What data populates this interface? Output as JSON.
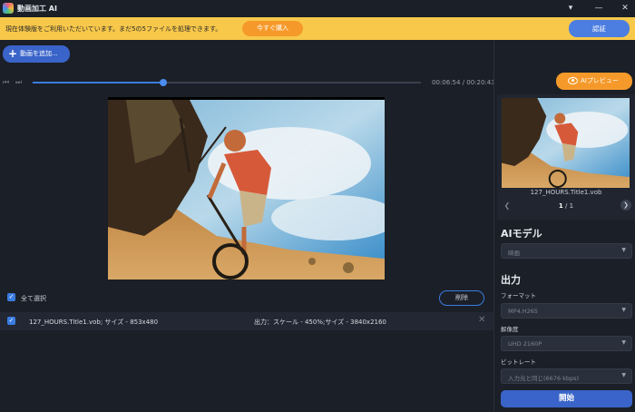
{
  "app": {
    "title": "動画加工 AI"
  },
  "window_controls": {
    "menu": "▾",
    "minimize": "—",
    "close": "✕"
  },
  "banner": {
    "text": "現在体験版をご利用いただいています。まだ5の5ファイルを処理できます。",
    "buy_label": "今すぐ購入",
    "auth_label": "認証",
    "bg_color": "#f8c84a",
    "buy_color": "#f59a2a"
  },
  "toolbar": {
    "add_video_label": "動画を追加..."
  },
  "player": {
    "time": "00:06:54 / 00:20:43",
    "progress": 0.333,
    "prev_icon": "skip-back-icon",
    "next_icon": "skip-forward-icon"
  },
  "list": {
    "select_all_label": "全て選択",
    "delete_label": "削除",
    "files": [
      {
        "name": "127_HOURS.Title1.vob; サイズ - 853x480",
        "output": "出力：スケール - 450%;サイズ - 3840x2160"
      }
    ]
  },
  "side": {
    "ai_preview_label": "AIプレビュー",
    "thumbnail_name": "127_HOURS.Title1.vob",
    "page_current": "1",
    "page_total": " / 1",
    "ai_model_heading": "AIモデル",
    "ai_model_value": "映画",
    "output_heading": "出力",
    "format_label": "フォーマット",
    "format_value": "MP4.H265",
    "resolution_label": "解像度",
    "resolution_value": "UHD 2160P",
    "bitrate_label": "ビットレート",
    "bitrate_value": "入力元と同じ(6676 kbps)",
    "start_label": "開始"
  },
  "colors": {
    "accent": "#3a64c9",
    "background": "#1b1f27",
    "panel": "#20252f"
  }
}
